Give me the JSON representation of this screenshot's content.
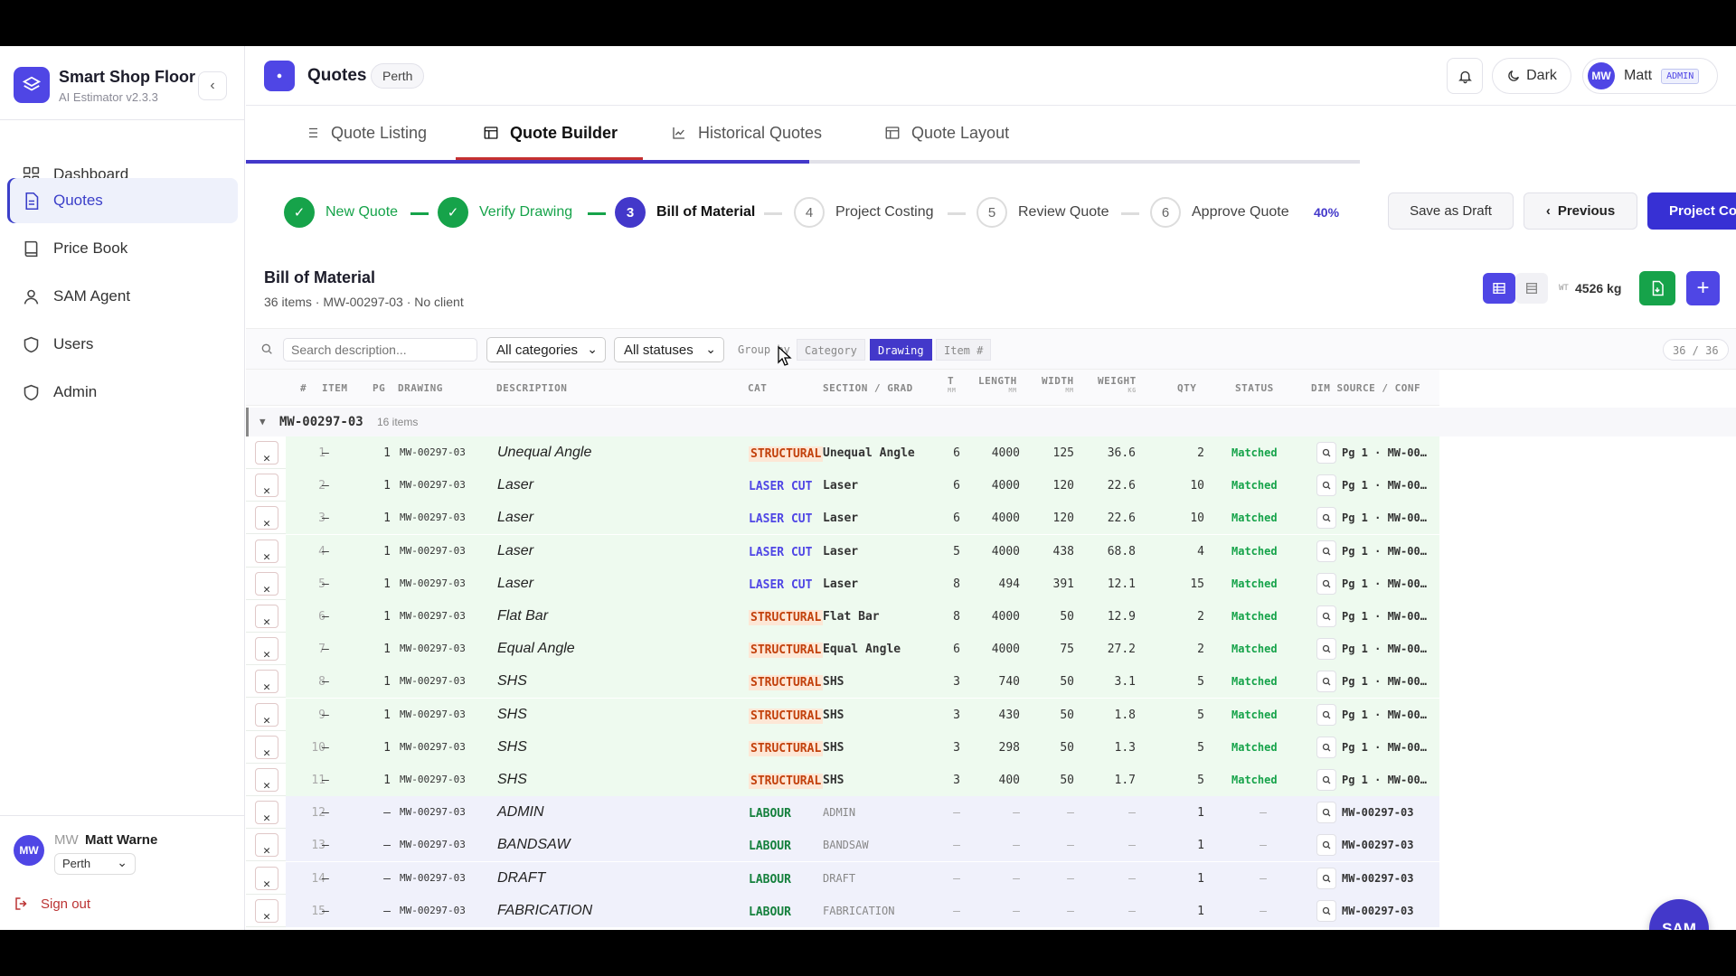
{
  "app": {
    "title": "Smart Shop Floor",
    "version": "AI Estimator v2.3.3"
  },
  "sidebar": {
    "items": [
      {
        "label": "Dashboard",
        "icon": "grid-icon"
      },
      {
        "label": "Quotes",
        "icon": "document-icon",
        "active": true
      },
      {
        "label": "Price Book",
        "icon": "book-icon"
      },
      {
        "label": "SAM Agent",
        "icon": "user-icon"
      },
      {
        "label": "Users",
        "icon": "shield-icon"
      },
      {
        "label": "Admin",
        "icon": "shield-icon"
      }
    ],
    "user": {
      "initials": "MW",
      "name": "Matt Warne",
      "location": "Perth"
    },
    "signout": "Sign out"
  },
  "header": {
    "title": "Quotes",
    "location": "Perth",
    "theme_label": "Dark",
    "user_initials": "MW",
    "user_name": "Matt",
    "role": "ADMIN"
  },
  "tabs": [
    "Quote Listing",
    "Quote Builder",
    "Historical Quotes",
    "Quote Layout"
  ],
  "progress_fraction": 0.4,
  "stepper": {
    "steps": [
      {
        "num": "1",
        "label": "New Quote",
        "state": "done"
      },
      {
        "num": "2",
        "label": "Verify Drawing",
        "state": "done"
      },
      {
        "num": "3",
        "label": "Bill of Material",
        "state": "current"
      },
      {
        "num": "4",
        "label": "Project Costing",
        "state": "pending"
      },
      {
        "num": "5",
        "label": "Review Quote",
        "state": "pending"
      },
      {
        "num": "6",
        "label": "Approve Quote",
        "state": "pending"
      }
    ],
    "percent": "40%",
    "save_draft": "Save as Draft",
    "previous": "Previous",
    "next": "Project Co"
  },
  "bom": {
    "title": "Bill of Material",
    "subtitle": "36 items · MW-00297-03 · No client",
    "weight_label": "WT",
    "weight": "4526 kg"
  },
  "filters": {
    "search_placeholder": "Search description...",
    "categories": "All categories",
    "statuses": "All statuses",
    "group_by_label": "Group by",
    "group_options": [
      "Category",
      "Drawing",
      "Item #"
    ],
    "group_active": "Drawing",
    "count": "36 / 36"
  },
  "table": {
    "headers": {
      "num": "#",
      "item": "ITEM",
      "pg": "PG",
      "drawing": "DRAWING",
      "description": "DESCRIPTION",
      "cat": "CAT",
      "section": "SECTION / GRAD",
      "t": "T",
      "t_unit": "MM",
      "length": "LENGTH",
      "length_unit": "MM",
      "width": "WIDTH",
      "width_unit": "MM",
      "weight": "WEIGHT",
      "weight_unit": "KG",
      "qty": "QTY",
      "status": "STATUS",
      "dim": "DIM SOURCE / CONF"
    },
    "group": {
      "name": "MW-00297-03",
      "count": "16 items"
    },
    "rows": [
      {
        "num": "1",
        "item": "—",
        "pg": "1",
        "drawing": "MW-00297-03",
        "desc": "Unequal Angle",
        "cat": "STRUCTURAL",
        "section": "Unequal Angle",
        "t": "6",
        "length": "4000",
        "width": "125",
        "weight": "36.6",
        "qty": "2",
        "status": "Matched",
        "src": "Pg 1 · MW-00…"
      },
      {
        "num": "2",
        "item": "—",
        "pg": "1",
        "drawing": "MW-00297-03",
        "desc": "Laser",
        "cat": "LASER CUT",
        "section": "Laser",
        "t": "6",
        "length": "4000",
        "width": "120",
        "weight": "22.6",
        "qty": "10",
        "status": "Matched",
        "src": "Pg 1 · MW-00…"
      },
      {
        "num": "3",
        "item": "—",
        "pg": "1",
        "drawing": "MW-00297-03",
        "desc": "Laser",
        "cat": "LASER CUT",
        "section": "Laser",
        "t": "6",
        "length": "4000",
        "width": "120",
        "weight": "22.6",
        "qty": "10",
        "status": "Matched",
        "src": "Pg 1 · MW-00…"
      },
      {
        "num": "4",
        "item": "—",
        "pg": "1",
        "drawing": "MW-00297-03",
        "desc": "Laser",
        "cat": "LASER CUT",
        "section": "Laser",
        "t": "5",
        "length": "4000",
        "width": "438",
        "weight": "68.8",
        "qty": "4",
        "status": "Matched",
        "src": "Pg 1 · MW-00…"
      },
      {
        "num": "5",
        "item": "—",
        "pg": "1",
        "drawing": "MW-00297-03",
        "desc": "Laser",
        "cat": "LASER CUT",
        "section": "Laser",
        "t": "8",
        "length": "494",
        "width": "391",
        "weight": "12.1",
        "qty": "15",
        "status": "Matched",
        "src": "Pg 1 · MW-00…"
      },
      {
        "num": "6",
        "item": "—",
        "pg": "1",
        "drawing": "MW-00297-03",
        "desc": "Flat Bar",
        "cat": "STRUCTURAL",
        "section": "Flat Bar",
        "t": "8",
        "length": "4000",
        "width": "50",
        "weight": "12.9",
        "qty": "2",
        "status": "Matched",
        "src": "Pg 1 · MW-00…"
      },
      {
        "num": "7",
        "item": "—",
        "pg": "1",
        "drawing": "MW-00297-03",
        "desc": "Equal Angle",
        "cat": "STRUCTURAL",
        "section": "Equal Angle",
        "t": "6",
        "length": "4000",
        "width": "75",
        "weight": "27.2",
        "qty": "2",
        "status": "Matched",
        "src": "Pg 1 · MW-00…"
      },
      {
        "num": "8",
        "item": "—",
        "pg": "1",
        "drawing": "MW-00297-03",
        "desc": "SHS",
        "cat": "STRUCTURAL",
        "section": "SHS",
        "t": "3",
        "length": "740",
        "width": "50",
        "weight": "3.1",
        "qty": "5",
        "status": "Matched",
        "src": "Pg 1 · MW-00…"
      },
      {
        "num": "9",
        "item": "—",
        "pg": "1",
        "drawing": "MW-00297-03",
        "desc": "SHS",
        "cat": "STRUCTURAL",
        "section": "SHS",
        "t": "3",
        "length": "430",
        "width": "50",
        "weight": "1.8",
        "qty": "5",
        "status": "Matched",
        "src": "Pg 1 · MW-00…"
      },
      {
        "num": "10",
        "item": "—",
        "pg": "1",
        "drawing": "MW-00297-03",
        "desc": "SHS",
        "cat": "STRUCTURAL",
        "section": "SHS",
        "t": "3",
        "length": "298",
        "width": "50",
        "weight": "1.3",
        "qty": "5",
        "status": "Matched",
        "src": "Pg 1 · MW-00…"
      },
      {
        "num": "11",
        "item": "—",
        "pg": "1",
        "drawing": "MW-00297-03",
        "desc": "SHS",
        "cat": "STRUCTURAL",
        "section": "SHS",
        "t": "3",
        "length": "400",
        "width": "50",
        "weight": "1.7",
        "qty": "5",
        "status": "Matched",
        "src": "Pg 1 · MW-00…"
      },
      {
        "num": "12",
        "item": "—",
        "pg": "—",
        "drawing": "MW-00297-03",
        "desc": "ADMIN",
        "cat": "LABOUR",
        "section": "ADMIN",
        "t": "—",
        "length": "—",
        "width": "—",
        "weight": "—",
        "qty": "1",
        "status": "—",
        "src": "MW-00297-03"
      },
      {
        "num": "13",
        "item": "—",
        "pg": "—",
        "drawing": "MW-00297-03",
        "desc": "BANDSAW",
        "cat": "LABOUR",
        "section": "BANDSAW",
        "t": "—",
        "length": "—",
        "width": "—",
        "weight": "—",
        "qty": "1",
        "status": "—",
        "src": "MW-00297-03"
      },
      {
        "num": "14",
        "item": "—",
        "pg": "—",
        "drawing": "MW-00297-03",
        "desc": "DRAFT",
        "cat": "LABOUR",
        "section": "DRAFT",
        "t": "—",
        "length": "—",
        "width": "—",
        "weight": "—",
        "qty": "1",
        "status": "—",
        "src": "MW-00297-03"
      },
      {
        "num": "15",
        "item": "—",
        "pg": "—",
        "drawing": "MW-00297-03",
        "desc": "FABRICATION",
        "cat": "LABOUR",
        "section": "FABRICATION",
        "t": "—",
        "length": "—",
        "width": "—",
        "weight": "—",
        "qty": "1",
        "status": "—",
        "src": "MW-00297-03"
      }
    ]
  },
  "sam_button": "SAM"
}
